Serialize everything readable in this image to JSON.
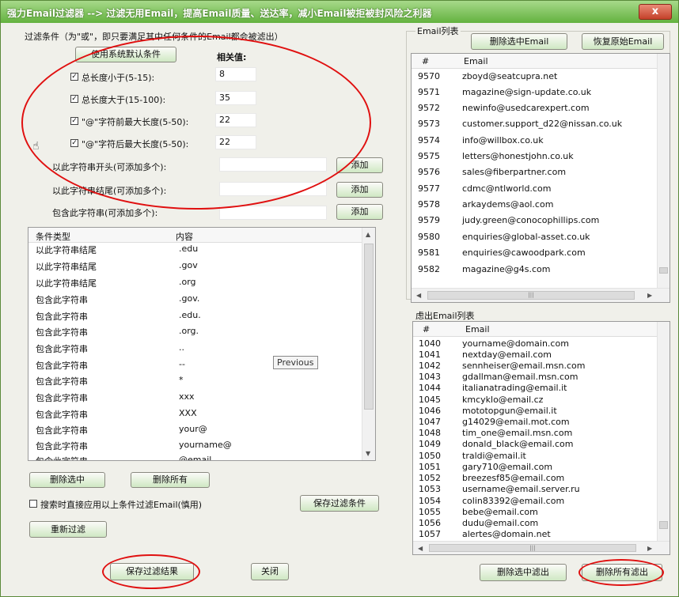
{
  "window": {
    "title": "强力Email过滤器 --> 过滤无用Email，提高Email质量、送达率，减小Email被拒被封风险之利器",
    "close_label": "x"
  },
  "filter": {
    "heading": "过滤条件（为\"或\"，即只要满足其中任何条件的Email都会被滤出）",
    "default_button": "使用系统默认条件",
    "relevance_header": "相关值:",
    "conditions": [
      {
        "label": "总长度小于(5-15):",
        "checked": true,
        "value": "8"
      },
      {
        "label": "总长度大于(15-100):",
        "checked": true,
        "value": "35"
      },
      {
        "label": "\"@\"字符前最大长度(5-50):",
        "checked": true,
        "value": "22"
      },
      {
        "label": "\"@\"字符后最大长度(5-50):",
        "checked": true,
        "value": "22"
      }
    ],
    "string_rules": [
      {
        "label": "以此字符串开头(可添加多个):",
        "value": "",
        "add_label": "添加"
      },
      {
        "label": "以此字符串结尾(可添加多个):",
        "value": "",
        "add_label": "添加"
      },
      {
        "label": "包含此字符串(可添加多个):",
        "value": "",
        "add_label": "添加"
      }
    ]
  },
  "conditions_table": {
    "columns": [
      "条件类型",
      "内容"
    ],
    "rows": [
      [
        "以此字符串结尾",
        ".edu"
      ],
      [
        "以此字符串结尾",
        ".gov"
      ],
      [
        "以此字符串结尾",
        ".org"
      ],
      [
        "包含此字符串",
        ".gov."
      ],
      [
        "包含此字符串",
        ".edu."
      ],
      [
        "包含此字符串",
        ".org."
      ],
      [
        "包含此字符串",
        ".."
      ],
      [
        "包含此字符串",
        "--"
      ],
      [
        "包含此字符串",
        "*"
      ],
      [
        "包含此字符串",
        "xxx"
      ],
      [
        "包含此字符串",
        "XXX"
      ],
      [
        "包含此字符串",
        "your@"
      ],
      [
        "包含此字符串",
        "yourname@"
      ],
      [
        "包含此字符串",
        "@email."
      ]
    ]
  },
  "tooltip": "Previous",
  "left_buttons": {
    "delete_selected": "删除选中",
    "delete_all": "删除所有",
    "apply_checkbox": "搜索时直接应用以上条件过滤Email(慎用)",
    "save_conditions": "保存过滤条件",
    "refilter": "重新过滤",
    "save_results": "保存过滤结果",
    "close": "关闭"
  },
  "email_list": {
    "title": "Email列表",
    "delete_selected": "删除选中Email",
    "restore": "恢复原始Email",
    "columns": [
      "#",
      "Email"
    ],
    "rows": [
      [
        "9570",
        "zboyd@seatcupra.net"
      ],
      [
        "9571",
        "magazine@sign-update.co.uk"
      ],
      [
        "9572",
        "newinfo@usedcarexpert.com"
      ],
      [
        "9573",
        "customer.support_d22@nissan.co.uk"
      ],
      [
        "9574",
        "info@willbox.co.uk"
      ],
      [
        "9575",
        "letters@honestjohn.co.uk"
      ],
      [
        "9576",
        "sales@fiberpartner.com"
      ],
      [
        "9577",
        "cdmc@ntlworld.com"
      ],
      [
        "9578",
        "arkaydems@aol.com"
      ],
      [
        "9579",
        "judy.green@conocophillips.com"
      ],
      [
        "9580",
        "enquiries@global-asset.co.uk"
      ],
      [
        "9581",
        "enquiries@cawoodpark.com"
      ],
      [
        "9582",
        "magazine@g4s.com"
      ]
    ]
  },
  "filtered_list": {
    "title": "虑出Email列表",
    "columns": [
      "#",
      "Email"
    ],
    "rows": [
      [
        "1040",
        "yourname@domain.com"
      ],
      [
        "1041",
        "nextday@email.com"
      ],
      [
        "1042",
        "sennheiser@email.msn.com"
      ],
      [
        "1043",
        "gdallman@email.msn.com"
      ],
      [
        "1044",
        "italianatrading@email.it"
      ],
      [
        "1045",
        "kmcyklo@email.cz"
      ],
      [
        "1046",
        "mototopgun@email.it"
      ],
      [
        "1047",
        "g14029@email.mot.com"
      ],
      [
        "1048",
        "tim_one@email.msn.com"
      ],
      [
        "1049",
        "donald_black@email.com"
      ],
      [
        "1050",
        "traldi@email.it"
      ],
      [
        "1051",
        "gary710@email.com"
      ],
      [
        "1052",
        "breezesf85@email.com"
      ],
      [
        "1053",
        "username@email.server.ru"
      ],
      [
        "1054",
        "colin83392@email.com"
      ],
      [
        "1055",
        "bebe@email.com"
      ],
      [
        "1056",
        "dudu@email.com"
      ],
      [
        "1057",
        "alertes@domain.net"
      ]
    ],
    "delete_selected": "删除选中滤出",
    "delete_all": "删除所有滤出"
  }
}
